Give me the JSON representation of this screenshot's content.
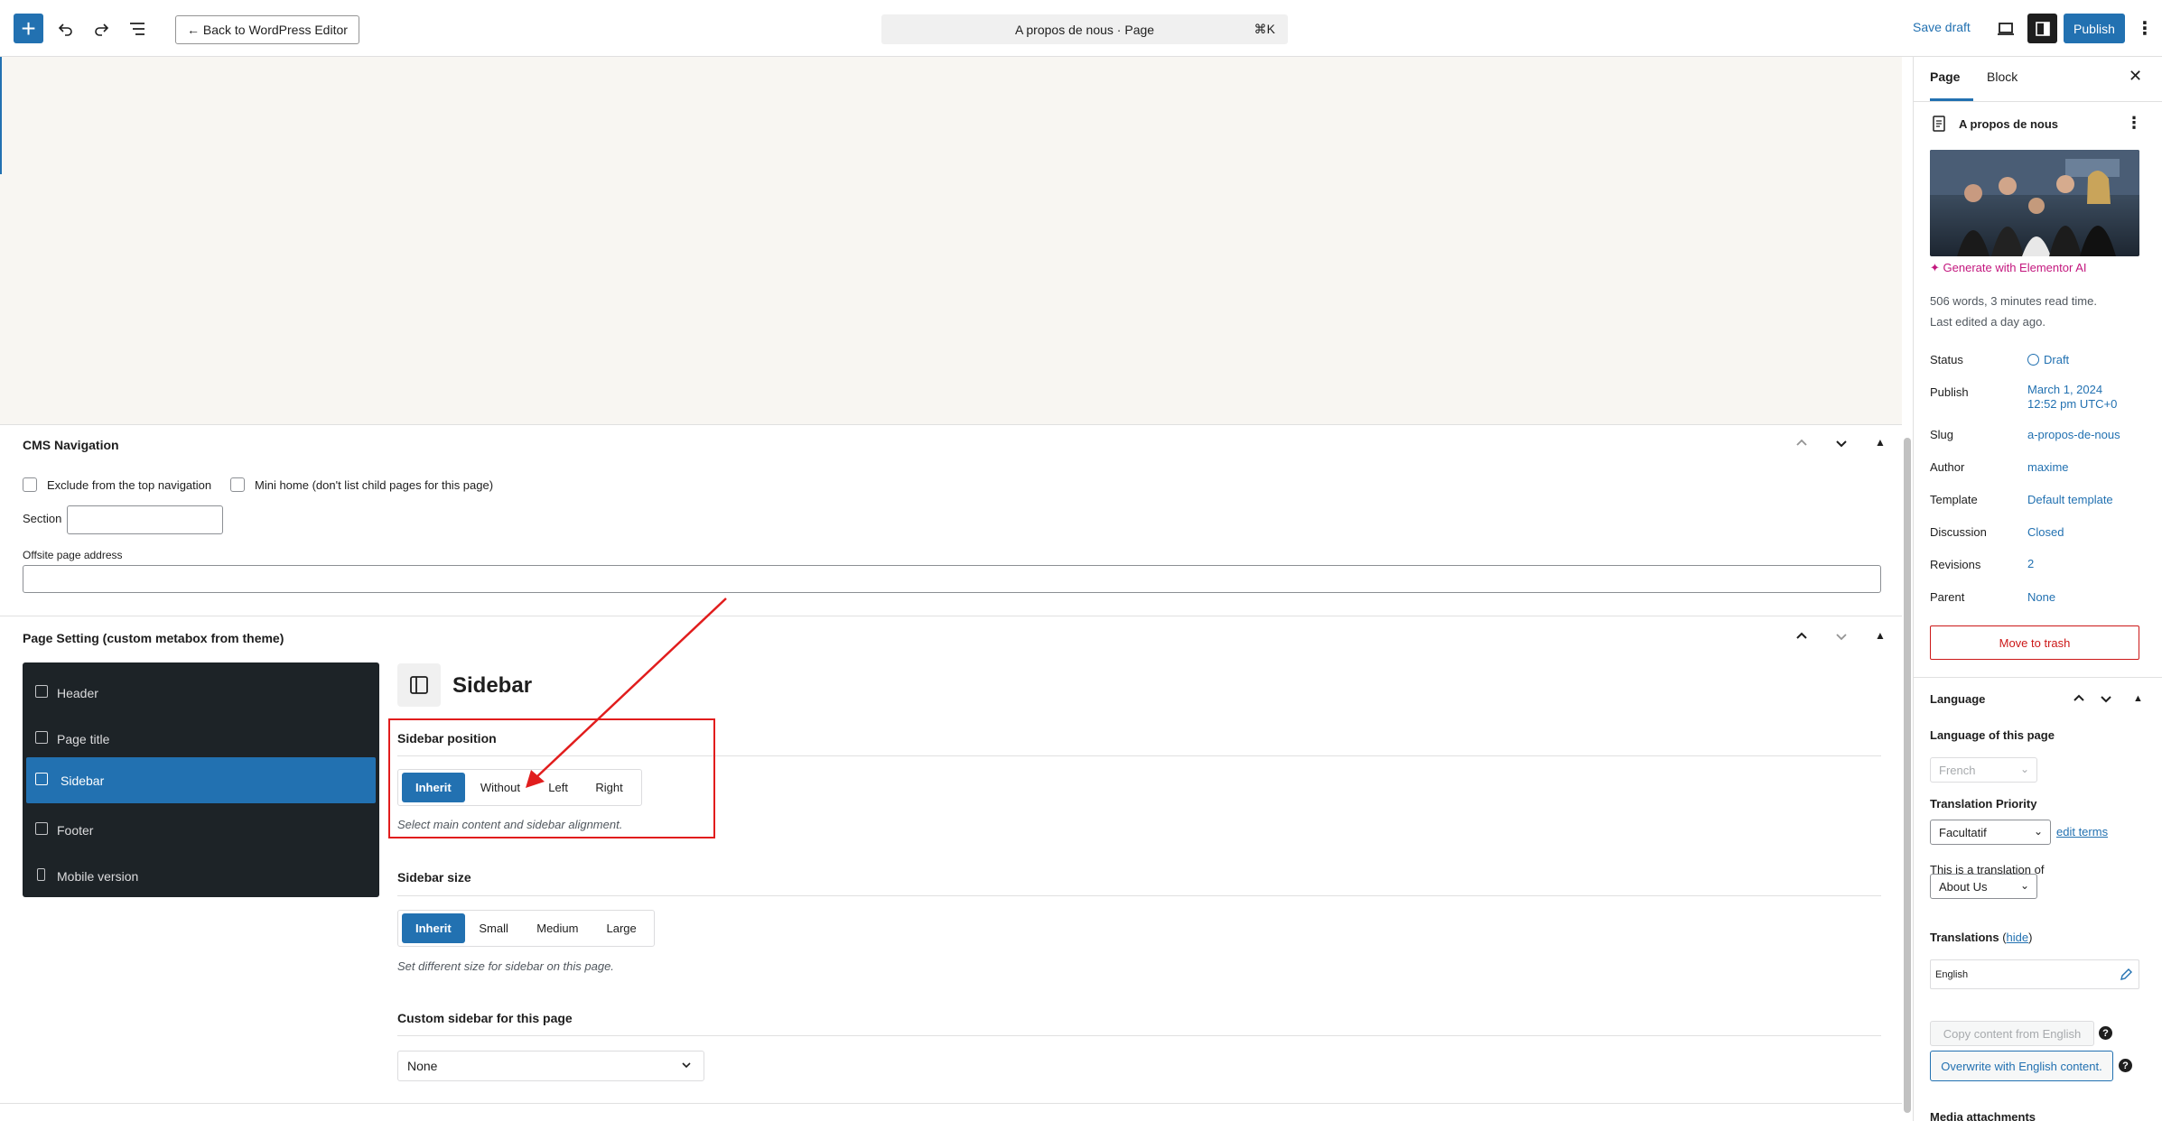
{
  "topbar": {
    "back_label": "← Back to WordPress Editor",
    "command_title": "A propos de nous · Page",
    "command_shortcut": "⌘K",
    "save_draft_label": "Save draft",
    "publish_label": "Publish"
  },
  "cms_nav": {
    "title": "CMS Navigation",
    "exclude_label": "Exclude from the top navigation",
    "mini_home_label": "Mini home (don't list child pages for this page)",
    "section_label": "Section",
    "section_value": "",
    "offsite_label": "Offsite page address",
    "offsite_value": ""
  },
  "page_setting": {
    "title": "Page Setting (custom metabox from theme)",
    "nav": [
      {
        "label": "Header"
      },
      {
        "label": "Page title"
      },
      {
        "label": "Sidebar",
        "active": true
      },
      {
        "label": "Footer"
      },
      {
        "label": "Mobile version"
      }
    ],
    "section_title": "Sidebar",
    "sidebar_position": {
      "label": "Sidebar position",
      "options": [
        "Inherit",
        "Without",
        "Left",
        "Right"
      ],
      "selected": "Inherit",
      "hint": "Select main content and sidebar alignment."
    },
    "sidebar_size": {
      "label": "Sidebar size",
      "options": [
        "Inherit",
        "Small",
        "Medium",
        "Large"
      ],
      "selected": "Inherit",
      "hint": "Set different size for sidebar on this page."
    },
    "custom_sidebar": {
      "label": "Custom sidebar for this page",
      "value": "None"
    }
  },
  "panel": {
    "tab_page": "Page",
    "tab_block": "Block",
    "page_title": "A propos de nous",
    "generate_label": "Generate with Elementor AI",
    "stats_line1": "506 words, 3 minutes read time.",
    "stats_line2": "Last edited a day ago.",
    "rows": [
      {
        "label": "Status",
        "value": "Draft"
      },
      {
        "label": "Publish",
        "value": "March 1, 2024",
        "value2": "12:52 pm UTC+0"
      },
      {
        "label": "Slug",
        "value": "a-propos-de-nous"
      },
      {
        "label": "Author",
        "value": "maxime"
      },
      {
        "label": "Template",
        "value": "Default template"
      },
      {
        "label": "Discussion",
        "value": "Closed"
      },
      {
        "label": "Revisions",
        "value": "2"
      },
      {
        "label": "Parent",
        "value": "None"
      }
    ],
    "trash_label": "Move to trash",
    "language": {
      "title": "Language",
      "lang_label": "Language of this page",
      "lang_value": "French",
      "priority_label": "Translation Priority",
      "priority_value": "Facultatif",
      "edit_terms": "edit terms",
      "translation_of_label": "This is a translation of",
      "translation_of_value": "About Us",
      "translations_label": "Translations",
      "hide_label": "hide",
      "english_label": "English",
      "copy_label": "Copy content from English",
      "overwrite_label": "Overwrite with English content.",
      "media_label": "Media attachments"
    }
  },
  "colors": {
    "accent": "#2271b1",
    "dark_nav": "#1d2327",
    "annotation_red": "#e11d1d",
    "ai_magenta": "#c3177e"
  }
}
